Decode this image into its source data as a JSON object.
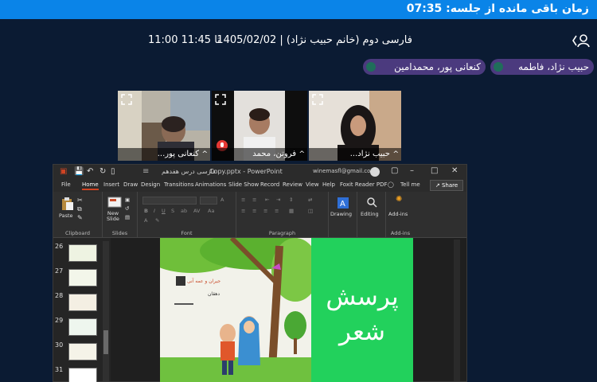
{
  "header": {
    "timer_text": "زمان باقی مانده از جلسه: 07:35",
    "session_title": "فارسی دوم (خانم حبیب نژاد) | 1405/02/02",
    "session_time": "11:00 تا 11:45"
  },
  "participants": [
    {
      "label": "حبیب نژاد، فاطمه"
    },
    {
      "label": "کنعانی پور، محمدامین"
    }
  ],
  "tiles": [
    {
      "name": "کنعانی پور..."
    },
    {
      "name": "فروتن، محمد"
    },
    {
      "name": "حبیب نژاد..."
    }
  ],
  "powerpoint": {
    "doc_title": "Copy.pptx  -  PowerPoint",
    "doc_title_fa": "فارسی درس هفدهم",
    "account": "winemasfl@gmail.com",
    "tabs": [
      "File",
      "Home",
      "Insert",
      "Draw",
      "Design",
      "Transitions",
      "Animations",
      "Slide Show",
      "Record",
      "Review",
      "View",
      "Help",
      "Foxit Reader PDF"
    ],
    "active_tab": "Home",
    "tell_me": "Tell me",
    "share_label": "Share",
    "groups": {
      "clipboard": "Clipboard",
      "slides": "Slides",
      "font": "Font",
      "paragraph": "Paragraph",
      "addins": "Add-ins"
    },
    "buttons": {
      "paste": "Paste",
      "new_slide": "New\nSlide",
      "drawing": "Drawing",
      "editing": "Editing",
      "addins": "Add-ins"
    },
    "slide_numbers": [
      "26",
      "27",
      "28",
      "29",
      "30",
      "31"
    ],
    "slide_text": "پرسش\nشعر",
    "slide_book_heading": "جیران و عمه آنی",
    "slide_book_sub": "دهقان"
  },
  "colors": {
    "background": "#0b1b33",
    "topbar": "#0a84e8",
    "chip": "#4b3a7e",
    "slide_green": "#22d15c"
  }
}
